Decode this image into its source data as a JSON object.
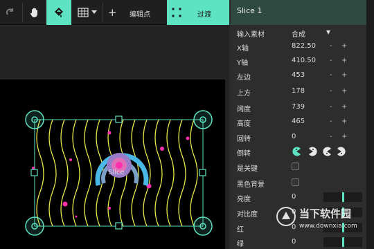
{
  "toolbar": {
    "add_keypoint_label": "编辑点",
    "transition_label": "过渡",
    "plus_symbol": "+"
  },
  "stage": {
    "slice_label": "Slice"
  },
  "panel": {
    "title": "Slice 1",
    "rows": [
      {
        "label": "输入素材",
        "value": "合成",
        "type": "dropdown"
      },
      {
        "label": "X轴",
        "value": "822.50",
        "type": "number"
      },
      {
        "label": "Y轴",
        "value": "410.50",
        "type": "number"
      },
      {
        "label": "左边",
        "value": "453",
        "type": "number"
      },
      {
        "label": "上方",
        "value": "178",
        "type": "number"
      },
      {
        "label": "阔度",
        "value": "739",
        "type": "number"
      },
      {
        "label": "高度",
        "value": "465",
        "type": "number"
      },
      {
        "label": "回转",
        "value": "0",
        "type": "number"
      },
      {
        "label": "倒转",
        "value": "",
        "type": "orientation"
      },
      {
        "label": "是关键",
        "value": "",
        "type": "checkbox"
      },
      {
        "label": "黑色背景",
        "value": "",
        "type": "checkbox"
      },
      {
        "label": "亮度",
        "value": "0",
        "type": "slider"
      },
      {
        "label": "对比度",
        "value": "0",
        "type": "slider"
      },
      {
        "label": "红",
        "value": "0",
        "type": "slider"
      },
      {
        "label": "绿",
        "value": "0",
        "type": "slider"
      }
    ],
    "minus_symbol": "-",
    "plus_symbol": "+"
  },
  "watermark": {
    "brand": "当下软件园",
    "url": "www.downxia.com"
  },
  "colors": {
    "accent": "#5de3c2",
    "wave_lines": "#e8e84a",
    "handles": "#5de3c2",
    "magenta_dots": "#ff2fb0",
    "target_cyan": "#49b8e6"
  }
}
